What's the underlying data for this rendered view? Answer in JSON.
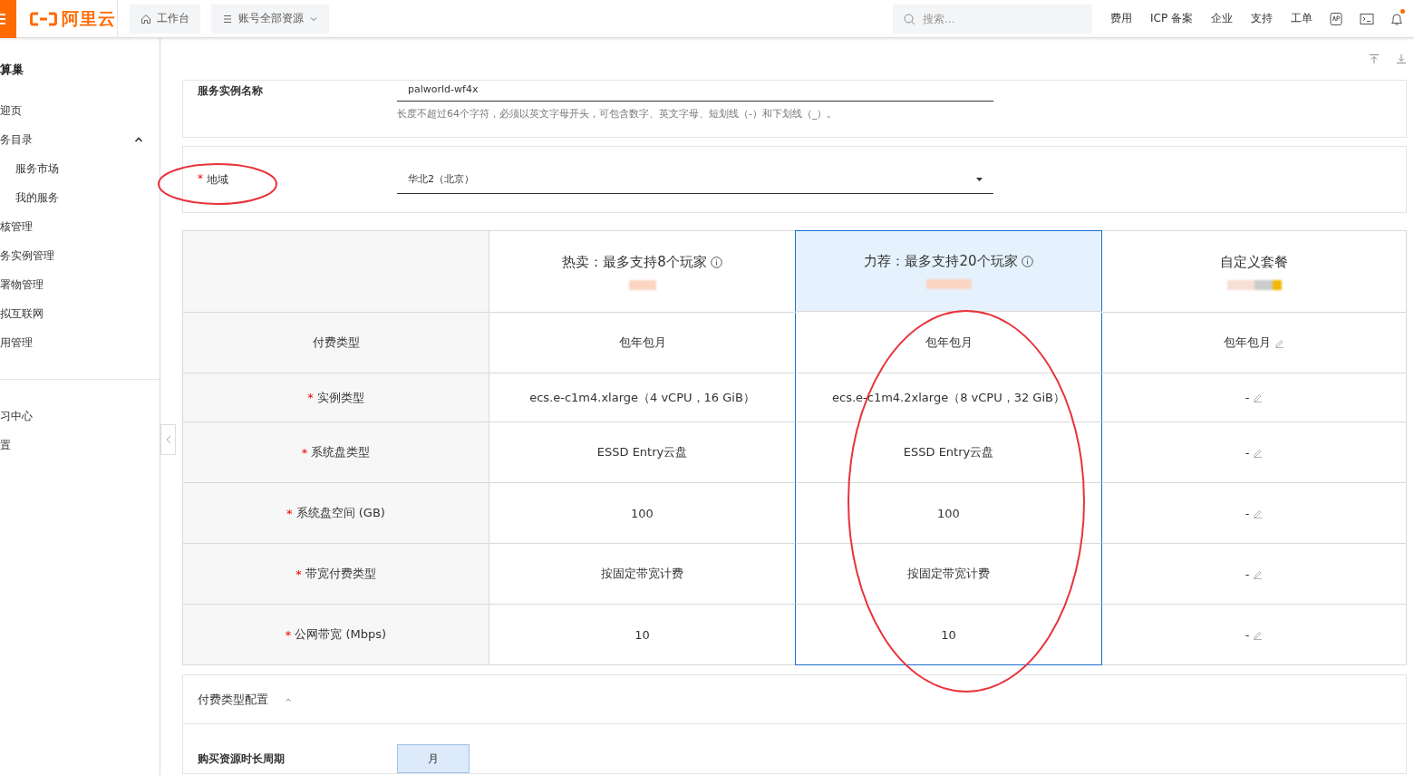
{
  "topbar": {
    "logo_text": "阿里云",
    "nav_buttons": [
      {
        "label": "工作台",
        "kind": "home"
      },
      {
        "label": "账号全部资源",
        "kind": "dropdown"
      }
    ],
    "search": {
      "placeholder": "搜索..."
    },
    "links": [
      "费用",
      "ICP 备案",
      "企业",
      "支持",
      "工单"
    ],
    "notifications": {
      "unread": true
    }
  },
  "sidebar": {
    "title": "算巢",
    "items": [
      {
        "label": "迎页"
      },
      {
        "label": "务目录",
        "expanded": true,
        "children": [
          {
            "label": "服务市场"
          },
          {
            "label": "我的服务"
          }
        ]
      },
      {
        "label": "核管理"
      },
      {
        "label": "务实例管理"
      },
      {
        "label": "署物管理"
      },
      {
        "label": "拟互联网"
      },
      {
        "label": "用管理"
      }
    ],
    "footer_items": [
      {
        "label": "习中心"
      },
      {
        "label": "置"
      }
    ]
  },
  "instance_name": {
    "label": "服务实例名称",
    "value": "palworld-wf4x",
    "hint": "长度不超过64个字符，必须以英文字母开头，可包含数字、英文字母、短划线（-）和下划线（_）。"
  },
  "region": {
    "label": "地域",
    "required_mark": "*",
    "value": "华北2（北京）"
  },
  "plans": {
    "columns": [
      {
        "title": "热卖：最多支持8个玩家",
        "kind": "preset",
        "selected": false
      },
      {
        "title": "力荐：最多支持20个玩家",
        "kind": "preset",
        "selected": true
      },
      {
        "title": "自定义套餐",
        "kind": "custom",
        "selected": false
      }
    ],
    "rows": [
      {
        "label": "付费类型",
        "cells": [
          {
            "value": "包年包月",
            "editable": false
          },
          {
            "value": "包年包月",
            "editable": false
          },
          {
            "value": "包年包月",
            "editable": true
          }
        ]
      },
      {
        "label": "实例类型",
        "required_mark": "*",
        "cells": [
          {
            "value": "ecs.e-c1m4.xlarge（4 vCPU，16 GiB）",
            "editable": false
          },
          {
            "value": "ecs.e-c1m4.2xlarge（8 vCPU，32 GiB）",
            "editable": false
          },
          {
            "value": "-",
            "editable": true
          }
        ]
      },
      {
        "label": "系统盘类型",
        "required_mark": "*",
        "cells": [
          {
            "value": "ESSD Entry云盘",
            "editable": false
          },
          {
            "value": "ESSD Entry云盘",
            "editable": false
          },
          {
            "value": "-",
            "editable": true
          }
        ]
      },
      {
        "label": "系统盘空间 (GB)",
        "required_mark": "*",
        "cells": [
          {
            "value": "100",
            "editable": false
          },
          {
            "value": "100",
            "editable": false
          },
          {
            "value": "-",
            "editable": true
          }
        ]
      },
      {
        "label": "带宽付费类型",
        "required_mark": "*",
        "cells": [
          {
            "value": "按固定带宽计费",
            "editable": false
          },
          {
            "value": "按固定带宽计费",
            "editable": false
          },
          {
            "value": "-",
            "editable": true
          }
        ]
      },
      {
        "label": "公网带宽 (Mbps)",
        "required_mark": "*",
        "cells": [
          {
            "value": "10",
            "editable": false
          },
          {
            "value": "10",
            "editable": false
          },
          {
            "value": "-",
            "editable": true
          }
        ]
      }
    ]
  },
  "billing_section": {
    "title": "付费类型配置",
    "expanded": true,
    "period": {
      "label": "购买资源时长周期",
      "options": [
        {
          "label": "月",
          "selected": true
        }
      ]
    }
  }
}
